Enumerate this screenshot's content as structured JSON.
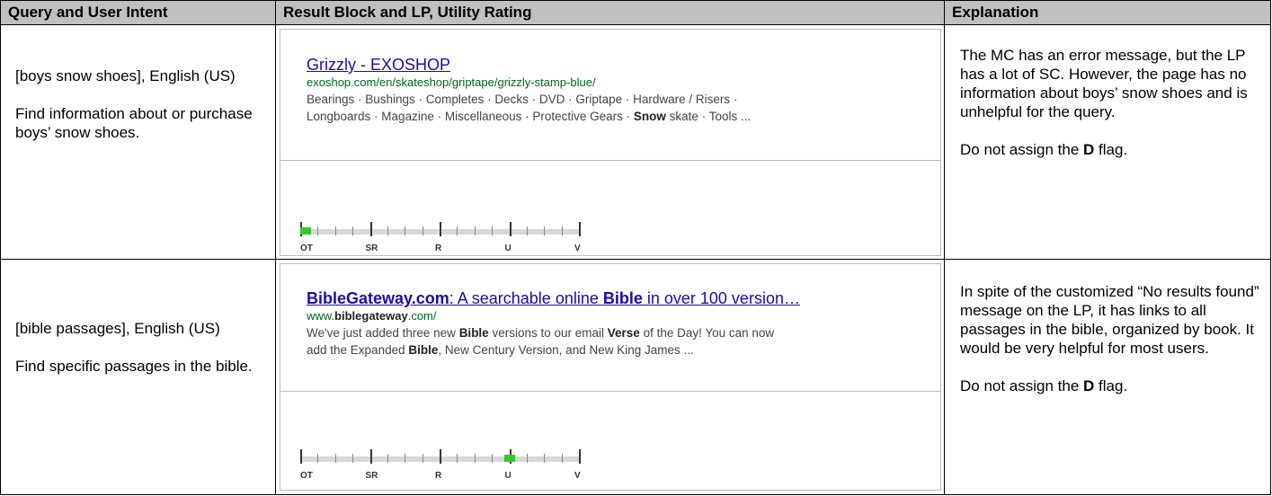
{
  "headers": {
    "col1": "Query and User Intent",
    "col2": "Result Block and LP, Utility Rating",
    "col3": "Explanation"
  },
  "rows": [
    {
      "query": "[boys snow shoes], English (US)",
      "intent": "Find information about or purchase boys’ snow shoes.",
      "result": {
        "title": "Grizzly - EXOSHOP",
        "url": "exoshop.com/en/skateshop/griptape/grizzly-stamp-blue/",
        "snippet_a": "Bearings · Bushings · Completes · Decks · DVD · Griptape · Hardware / Risers ·",
        "snippet_b_pre": "Longboards · Magazine · Miscellaneous · Protective Gears · ",
        "snippet_b_bold": "Snow",
        "snippet_b_post": " skate · Tools ..."
      },
      "rating": {
        "labels": [
          "OT",
          "SR",
          "R",
          "U",
          "V"
        ],
        "level": 0.0
      },
      "explanation": "The MC has an error message, but the LP has a lot of SC.  However, the page has no information about boys’ snow shoes and is unhelpful for the query.",
      "flag_pre": "Do not assign the ",
      "flag": "D",
      "flag_post": " flag."
    },
    {
      "query": "[bible passages], English (US)",
      "intent": "Find specific passages in the bible.",
      "result": {
        "title_b1": "BibleGateway.com",
        "title_m": ": A searchable online ",
        "title_b2": "Bible",
        "title_post": " in over 100 version…",
        "url_pre": "www.",
        "url_bold": "biblegateway",
        "url_post": ".com/",
        "snippet_a_pre": "We've just added three new ",
        "snippet_a_b1": "Bible",
        "snippet_a_mid": " versions to our email ",
        "snippet_a_b2": "Verse",
        "snippet_a_post": " of the Day! You can now",
        "snippet_b_pre": "add the Expanded ",
        "snippet_b_b": "Bible",
        "snippet_b_post": ", New Century Version, and New King James ..."
      },
      "rating": {
        "labels": [
          "OT",
          "SR",
          "R",
          "U",
          "V"
        ],
        "level": 0.75
      },
      "explanation": "In spite of the customized “No results found” message on the LP, it has links to all passages in the bible, organized by book.  It would be very helpful for most users.",
      "flag_pre": "Do not assign the ",
      "flag": "D",
      "flag_post": " flag."
    }
  ]
}
